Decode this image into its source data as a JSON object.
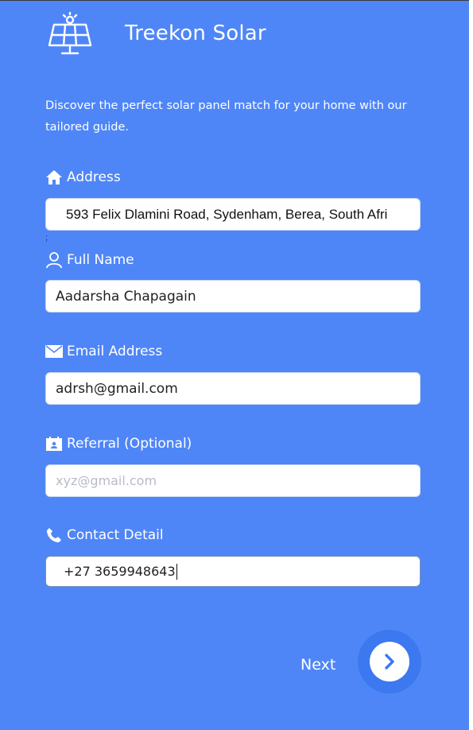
{
  "brand": {
    "name": "Treekon Solar",
    "logo_icon": "solar-panel-icon"
  },
  "intro": "Discover the perfect solar panel match for your home with our tailored guide.",
  "address": {
    "label": "Address",
    "icon": "home-icon",
    "value": "593 Felix Dlamini Road, Sydenham, Berea, South Afri",
    "trailing_char": ";"
  },
  "full_name": {
    "label": "Full Name",
    "icon": "user-icon",
    "value": "Aadarsha Chapagain"
  },
  "email": {
    "label": "Email Address",
    "icon": "envelope-icon",
    "value": "adrsh@gmail.com"
  },
  "referral": {
    "label": "Referral (Optional)",
    "icon": "contact-card-icon",
    "placeholder": "xyz@gmail.com"
  },
  "contact": {
    "label": "Contact Detail",
    "icon": "phone-icon",
    "value": "+27 3659948643"
  },
  "next": {
    "label": "Next",
    "icon": "chevron-right-icon"
  },
  "colors": {
    "background": "#4f86f7",
    "button": "#3c78ef",
    "field": "#ffffff"
  }
}
